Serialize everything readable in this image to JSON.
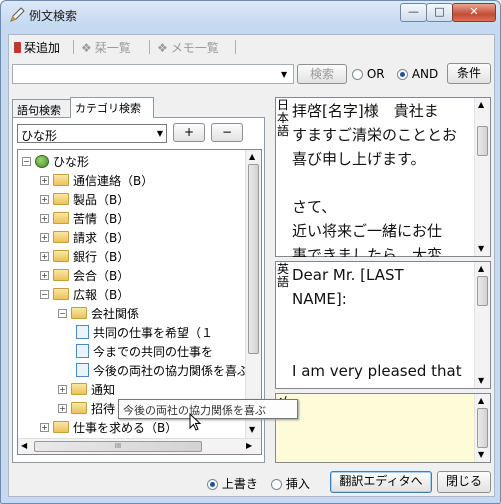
{
  "window": {
    "title": "例文検索",
    "min_icon": "minimize-icon",
    "max_icon": "maximize-icon",
    "close_icon": "close-icon"
  },
  "toolbar": {
    "add_bookmark": "栞追加",
    "bookmark_list": "栞一覧",
    "memo_list": "メモ一覧"
  },
  "search": {
    "value": "",
    "button": "検索",
    "or_label": "OR",
    "and_label": "AND",
    "and_selected": true,
    "condition_button": "条件"
  },
  "tabs": {
    "phrase": "語句検索",
    "category": "カテゴリ検索",
    "active": "category"
  },
  "category": {
    "selected": "ひな形",
    "add_button": "+",
    "remove_button": "−"
  },
  "tree": {
    "root": "ひな形",
    "items": [
      {
        "label": "通信連絡（B）",
        "level": 1,
        "type": "folder",
        "expanded": false
      },
      {
        "label": "製品（B）",
        "level": 1,
        "type": "folder",
        "expanded": false
      },
      {
        "label": "苦情（B）",
        "level": 1,
        "type": "folder",
        "expanded": false
      },
      {
        "label": "請求（B）",
        "level": 1,
        "type": "folder",
        "expanded": false
      },
      {
        "label": "銀行（B）",
        "level": 1,
        "type": "folder",
        "expanded": false
      },
      {
        "label": "会合（B）",
        "level": 1,
        "type": "folder",
        "expanded": false
      },
      {
        "label": "広報（B）",
        "level": 1,
        "type": "folder",
        "expanded": true
      },
      {
        "label": "会社関係",
        "level": 2,
        "type": "folder",
        "expanded": true
      },
      {
        "label": "共同の仕事を希望（１",
        "level": 3,
        "type": "doc"
      },
      {
        "label": "今までの共同の仕事を",
        "level": 3,
        "type": "doc"
      },
      {
        "label": "今後の両社の協力関係を喜ぶ",
        "level": 3,
        "type": "doc"
      },
      {
        "label": "通知",
        "level": 2,
        "type": "folder",
        "expanded": false
      },
      {
        "label": "招待",
        "level": 2,
        "type": "folder",
        "expanded": false
      },
      {
        "label": "仕事を求める（B）",
        "level": 1,
        "type": "folder",
        "expanded": false
      }
    ],
    "tooltip": "今後の両社の協力関係を喜ぶ",
    "hscroll_label": "III"
  },
  "japanese_pane": {
    "label": "日本語",
    "lines": [
      "拝啓[名字]様　貴社ま",
      "すますご清栄のこととお",
      "喜び申し上げます。",
      "",
      "さて、",
      "近い将来ご一緒にお仕",
      "事できましたら、大変"
    ]
  },
  "english_pane": {
    "label": "英語",
    "lines": [
      "Dear Mr. [LAST",
      "NAME]:",
      "",
      "",
      "I am very pleased that"
    ]
  },
  "memo_pane": {
    "label": "メモ",
    "text": "",
    "bg_color": "#fdfbd8"
  },
  "bottom": {
    "overwrite": "上書き",
    "insert": "挿入",
    "overwrite_selected": true,
    "translate_editor": "翻訳エディタへ",
    "close": "閉じる"
  }
}
